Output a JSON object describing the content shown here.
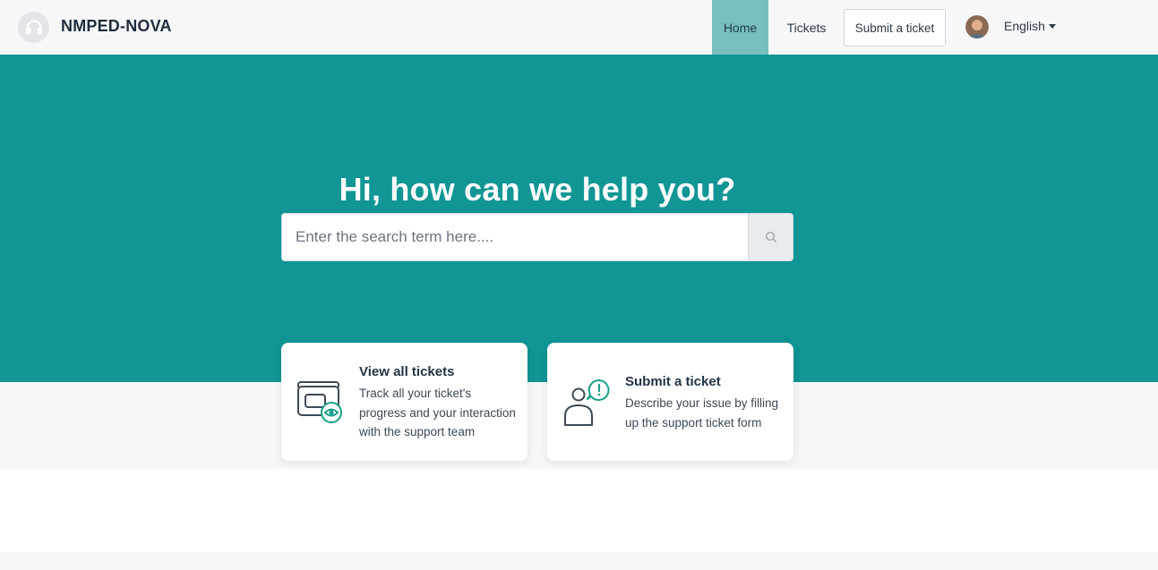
{
  "header": {
    "brand": "NMPED-NOVA",
    "nav": {
      "home": "Home",
      "tickets": "Tickets",
      "submit": "Submit a ticket"
    },
    "language": "English"
  },
  "hero": {
    "title": "Hi, how can we help you?",
    "search_placeholder": "Enter the search term here...."
  },
  "cards": [
    {
      "title": "View all tickets",
      "description": "Track all your ticket's progress and your interaction with the support team",
      "icon": "ticket-eye-icon"
    },
    {
      "title": "Submit a ticket",
      "description": "Describe your issue by filling up the support ticket form",
      "icon": "user-alert-icon"
    }
  ],
  "colors": {
    "hero_bg": "#119595",
    "nav_active": "#78bfc0",
    "accent": "#19a08a"
  }
}
